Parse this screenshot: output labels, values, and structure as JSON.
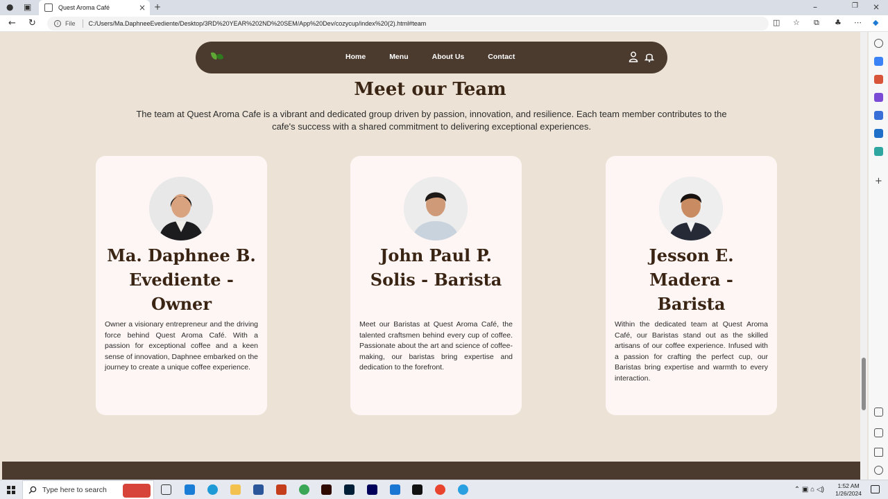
{
  "browser": {
    "tab_title": "Quest Aroma Café",
    "address_scheme": "File",
    "url": "C:/Users/Ma.DaphneeEvediente/Desktop/3RD%20YEAR%202ND%20SEM/App%20Dev/cozycup/index%20(2).html#team"
  },
  "nav": {
    "links": [
      "Home",
      "Menu",
      "About Us",
      "Contact"
    ],
    "icons": [
      "leaf-logo-icon",
      "user-icon",
      "bell-icon"
    ]
  },
  "team": {
    "heading": "Meet our Team",
    "intro": "The team at Quest Aroma Cafe is a vibrant and dedicated group driven by passion, innovation, and resilience. Each team member contributes to the cafe's success with a shared commitment to delivering exceptional experiences.",
    "members": [
      {
        "name": "Ma. Daphnee B. Evediente - Owner",
        "description": "Owner a visionary entrepreneur and the driving force behind Quest Aroma Café. With a passion for exceptional coffee and a keen sense of innovation, Daphnee embarked on the journey to create a unique coffee experience."
      },
      {
        "name": "John Paul P. Solis - Barista",
        "description": "Meet our Baristas at Quest Aroma Café, the talented craftsmen behind every cup of coffee. Passionate about the art and science of coffee-making, our baristas bring expertise and dedication to the forefront."
      },
      {
        "name": "Jesson E. Madera - Barista",
        "description": "Within the dedicated team at Quest Aroma Café, our Baristas stand out as the skilled artisans of our coffee experience. Infused with a passion for crafting the perfect cup, our Baristas bring expertise and warmth to every interaction."
      }
    ]
  },
  "taskbar": {
    "search_placeholder": "Type here to search",
    "time": "1:52 AM",
    "date": "1/26/2024"
  },
  "colors": {
    "nav_bg": "#4b3a2e",
    "page_bg": "#ece3d6",
    "card_bg": "#fdf6f4",
    "heading": "#3a2414"
  }
}
